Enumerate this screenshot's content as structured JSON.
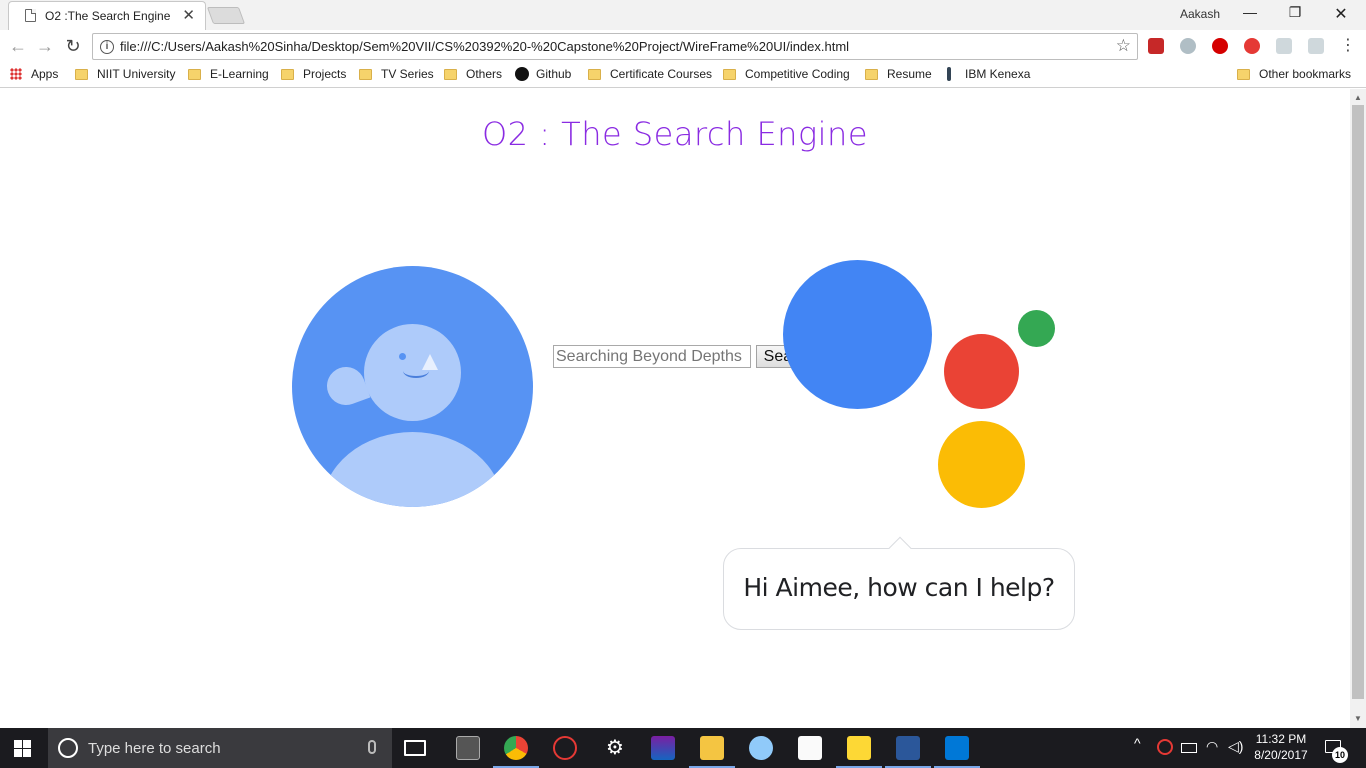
{
  "tab": {
    "title": "O2 :The Search Engine",
    "close": "✕"
  },
  "profile": {
    "name": "Aakash"
  },
  "window_controls": {
    "minimize": "—",
    "restore": "❐",
    "close": "✕"
  },
  "toolbar": {
    "back": "←",
    "forward": "→",
    "reload": "↻",
    "url": "file:///C:/Users/Aakash%20Sinha/Desktop/Sem%20VII/CS%20392%20-%20Capstone%20Project/WireFrame%20UI/index.html",
    "star": "☆"
  },
  "bookmarks": {
    "apps": "Apps",
    "items": [
      "NIIT University",
      "E-Learning",
      "Projects",
      "TV Series",
      "Others",
      "Github",
      "Certificate Courses",
      "Competitive Coding",
      "Resume",
      "IBM Kenexa"
    ],
    "other": "Other bookmarks"
  },
  "page": {
    "title": "O2 : The Search Engine",
    "search": {
      "placeholder": "Searching Beyond Depths",
      "button": "Search"
    },
    "assistant_message": "Hi Aimee, how can I help?"
  },
  "colors": {
    "title": "#8a2be2",
    "avatar_bg": "#5793f3",
    "avatar_light": "#aecbfa",
    "dot_blue": "#4285f4",
    "dot_red": "#ea4335",
    "dot_green": "#34a853",
    "dot_yellow": "#fbbc05"
  },
  "taskbar": {
    "search_placeholder": "Type here to search",
    "time": "11:32 PM",
    "date": "8/20/2017",
    "notification_count": "10",
    "tray_chevron": "^"
  }
}
